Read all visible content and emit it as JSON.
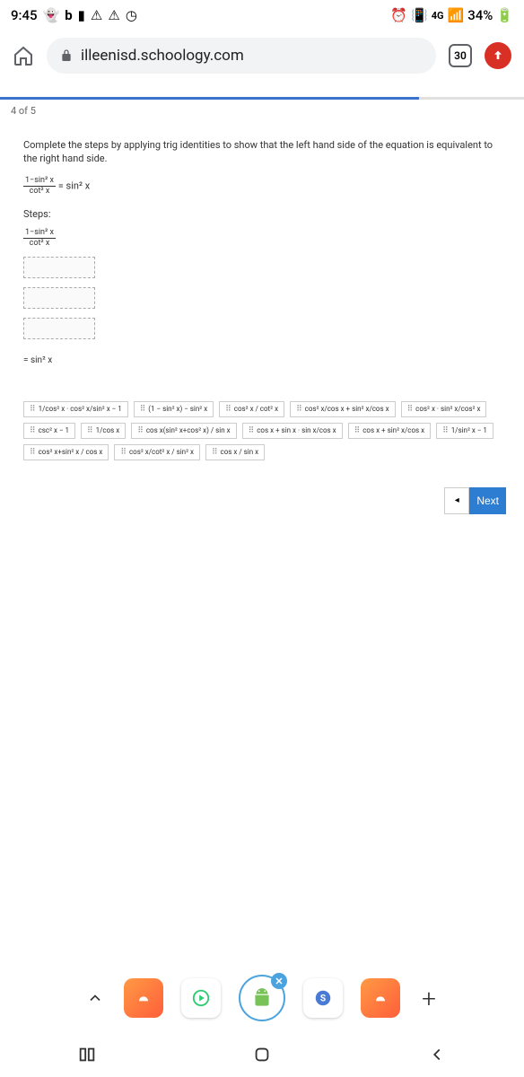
{
  "status": {
    "time": "9:45",
    "network": "4G",
    "battery": "34%"
  },
  "browser": {
    "url": "illeenisd.schoology.com",
    "tab_count": "30"
  },
  "progress": {
    "label": "4 of 5"
  },
  "question": {
    "text": "Complete the steps by applying trig identities to show that the left hand side of the equation is equivalent to the right hand side.",
    "equation_lhs_num": "1−sin² x",
    "equation_lhs_den": "cot² x",
    "equation_rhs": "= sin² x",
    "steps_label": "Steps:",
    "step1_num": "1−sin² x",
    "step1_den": "cot² x",
    "final": "= sin² x"
  },
  "tiles": {
    "t1": "1/cos² x · cos² x/sin² x − 1",
    "t2": "(1 − sin² x) − sin² x",
    "t3": "cos² x / cot² x",
    "t4": "cos² x/cos x + sin² x/cos x",
    "t5": "cos² x · sin² x/cos² x",
    "t6": "csc² x − 1",
    "t7": "1/cos x",
    "t8": "cos x(sin² x+cos² x) / sin x",
    "t9": "cos x + sin x · sin x/cos x",
    "t10": "cos x + sin² x/cos x",
    "t11": "1/sin² x − 1",
    "t12": "cos² x+sin² x / cos x",
    "t13": "cos² x/cot² x / sin² x",
    "t14": "cos x / sin x"
  },
  "nav": {
    "prev": "◂",
    "next": "Next"
  }
}
